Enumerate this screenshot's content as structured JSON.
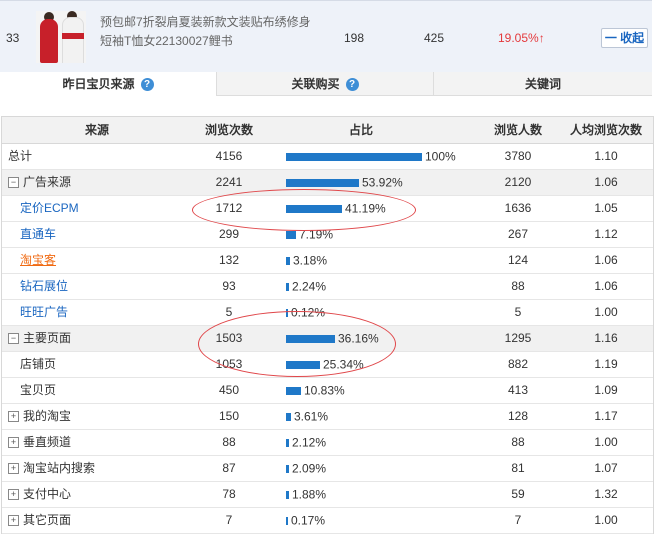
{
  "product": {
    "rank": "33",
    "title": "预包邮7折裂肩夏装新款文装贴布绣修身短袖T恤女22130027鲤书",
    "pv": "198",
    "uv": "425",
    "rate": "19.05%",
    "rate_arrow": "↑",
    "collapse_label": "一 收起"
  },
  "tabs": [
    {
      "label": "昨日宝贝来源",
      "help": true
    },
    {
      "label": "关联购买",
      "help": true
    },
    {
      "label": "关键词",
      "help": false
    }
  ],
  "table": {
    "headers": {
      "source": "来源",
      "pv": "浏览次数",
      "ratio": "占比",
      "uv": "浏览人数",
      "avg": "人均浏览次数"
    },
    "rows": [
      {
        "source": "总计",
        "pv": "4156",
        "ratio": "100%",
        "ratio_value": 100,
        "uv": "3780",
        "avg": "1.10"
      },
      {
        "source": "广告来源",
        "pv": "2241",
        "ratio": "53.92%",
        "ratio_value": 53.92,
        "uv": "2120",
        "avg": "1.06",
        "expander": "−"
      },
      {
        "source": "定价ECPM",
        "pv": "1712",
        "ratio": "41.19%",
        "ratio_value": 41.19,
        "uv": "1636",
        "avg": "1.05"
      },
      {
        "source": "直通车",
        "pv": "299",
        "ratio": "7.19%",
        "ratio_value": 7.19,
        "uv": "267",
        "avg": "1.12"
      },
      {
        "source": "淘宝客",
        "pv": "132",
        "ratio": "3.18%",
        "ratio_value": 3.18,
        "uv": "124",
        "avg": "1.06"
      },
      {
        "source": "钻石展位",
        "pv": "93",
        "ratio": "2.24%",
        "ratio_value": 2.24,
        "uv": "88",
        "avg": "1.06"
      },
      {
        "source": "旺旺广告",
        "pv": "5",
        "ratio": "0.12%",
        "ratio_value": 0.12,
        "uv": "5",
        "avg": "1.00"
      },
      {
        "source": "主要页面",
        "pv": "1503",
        "ratio": "36.16%",
        "ratio_value": 36.16,
        "uv": "1295",
        "avg": "1.16",
        "expander": "−"
      },
      {
        "source": "店铺页",
        "pv": "1053",
        "ratio": "25.34%",
        "ratio_value": 25.34,
        "uv": "882",
        "avg": "1.19"
      },
      {
        "source": "宝贝页",
        "pv": "450",
        "ratio": "10.83%",
        "ratio_value": 10.83,
        "uv": "413",
        "avg": "1.09"
      },
      {
        "source": "我的淘宝",
        "pv": "150",
        "ratio": "3.61%",
        "ratio_value": 3.61,
        "uv": "128",
        "avg": "1.17",
        "expander": "+"
      },
      {
        "source": "垂直频道",
        "pv": "88",
        "ratio": "2.12%",
        "ratio_value": 2.12,
        "uv": "88",
        "avg": "1.00",
        "expander": "+"
      },
      {
        "source": "淘宝站内搜索",
        "pv": "87",
        "ratio": "2.09%",
        "ratio_value": 2.09,
        "uv": "81",
        "avg": "1.07",
        "expander": "+"
      },
      {
        "source": "支付中心",
        "pv": "78",
        "ratio": "1.88%",
        "ratio_value": 1.88,
        "uv": "59",
        "avg": "1.32",
        "expander": "+"
      },
      {
        "source": "其它页面",
        "pv": "7",
        "ratio": "0.17%",
        "ratio_value": 0.17,
        "uv": "7",
        "avg": "1.00",
        "expander": "+"
      }
    ]
  },
  "colors": {
    "bar": "#1f78c8",
    "highlight_circle": "#e0474a",
    "rate_red": "#e4393c",
    "link_blue": "#1a66c0",
    "link_orange": "#f06a12"
  }
}
